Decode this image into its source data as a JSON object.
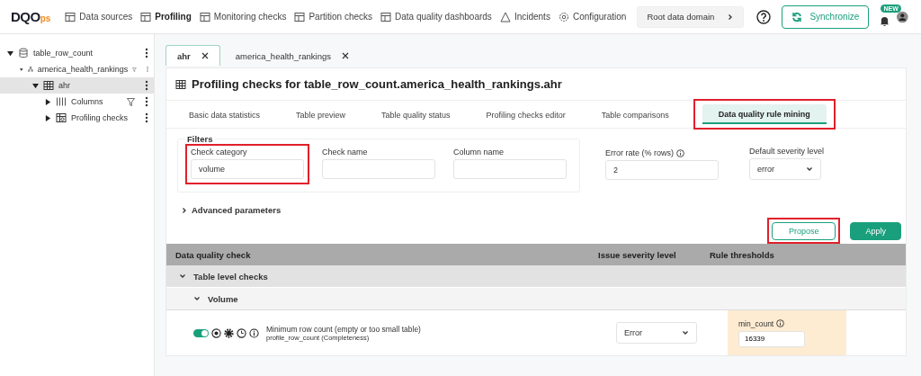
{
  "header": {
    "logo_main": "DQO",
    "logo_suffix": "ps",
    "nav": [
      {
        "label": "Data sources",
        "selected": false
      },
      {
        "label": "Profiling",
        "selected": true
      },
      {
        "label": "Monitoring checks",
        "selected": false
      },
      {
        "label": "Partition checks",
        "selected": false
      },
      {
        "label": "Data quality dashboards",
        "selected": false
      },
      {
        "label": "Incidents",
        "selected": false
      },
      {
        "label": "Configuration",
        "selected": false
      }
    ],
    "domain_button": "Root data domain",
    "sync_button": "Synchronize",
    "notification_badge": "NEW"
  },
  "tree": [
    {
      "label": "table_row_count",
      "kind": "database",
      "expanded": true,
      "selected": false,
      "filter": false,
      "children": [
        {
          "label": "america_health_rankings",
          "kind": "schema",
          "expanded": true,
          "selected": false,
          "filter": true,
          "children": [
            {
              "label": "ahr",
              "kind": "table",
              "expanded": true,
              "selected": true,
              "filter": false,
              "children": [
                {
                  "label": "Columns",
                  "kind": "columns",
                  "expanded": false,
                  "selected": false,
                  "filter": true
                },
                {
                  "label": "Profiling checks",
                  "kind": "checks",
                  "expanded": false,
                  "selected": false,
                  "filter": false
                }
              ]
            }
          ]
        }
      ]
    }
  ],
  "page_tabs": [
    {
      "label": "ahr",
      "selected": true
    },
    {
      "label": "america_health_rankings",
      "selected": false
    }
  ],
  "title": "Profiling checks for table_row_count.america_health_rankings.ahr",
  "tabs": [
    {
      "label": "Basic data statistics",
      "selected": false,
      "highlighted": false
    },
    {
      "label": "Table preview",
      "selected": false,
      "highlighted": false
    },
    {
      "label": "Table quality status",
      "selected": false,
      "highlighted": false
    },
    {
      "label": "Profiling checks editor",
      "selected": false,
      "highlighted": false
    },
    {
      "label": "Table comparisons",
      "selected": false,
      "highlighted": false
    },
    {
      "label": "Data quality rule mining",
      "selected": true,
      "highlighted": true
    }
  ],
  "filters": {
    "legend": "Filters",
    "fields": [
      {
        "label": "Check category",
        "value": "volume",
        "highlighted": true
      },
      {
        "label": "Check name",
        "highlighted": false
      },
      {
        "label": "Column name",
        "highlighted": false
      }
    ]
  },
  "error_rate": {
    "label": "Error rate (% rows)",
    "value": "2"
  },
  "default_severity": {
    "label": "Default severity level",
    "value": "error"
  },
  "advanced": {
    "label": "Advanced parameters",
    "expanded": false
  },
  "buttons": [
    {
      "label": "Propose",
      "kind": "outline",
      "highlighted": true
    },
    {
      "label": "Apply",
      "kind": "primary",
      "highlighted": false
    }
  ],
  "table": {
    "columns": [
      "Data quality check",
      "Issue severity level",
      "Rule thresholds"
    ],
    "group": {
      "label": "Table level checks",
      "expanded": true
    },
    "category": {
      "label": "Volume",
      "expanded": true
    },
    "rows": [
      {
        "enabled": true,
        "name": "Minimum row count (empty or too small table)",
        "subtitle": "profile_row_count (Completeness)",
        "severity": "Error",
        "threshold_label": "min_count",
        "threshold_value": "16339"
      }
    ]
  }
}
